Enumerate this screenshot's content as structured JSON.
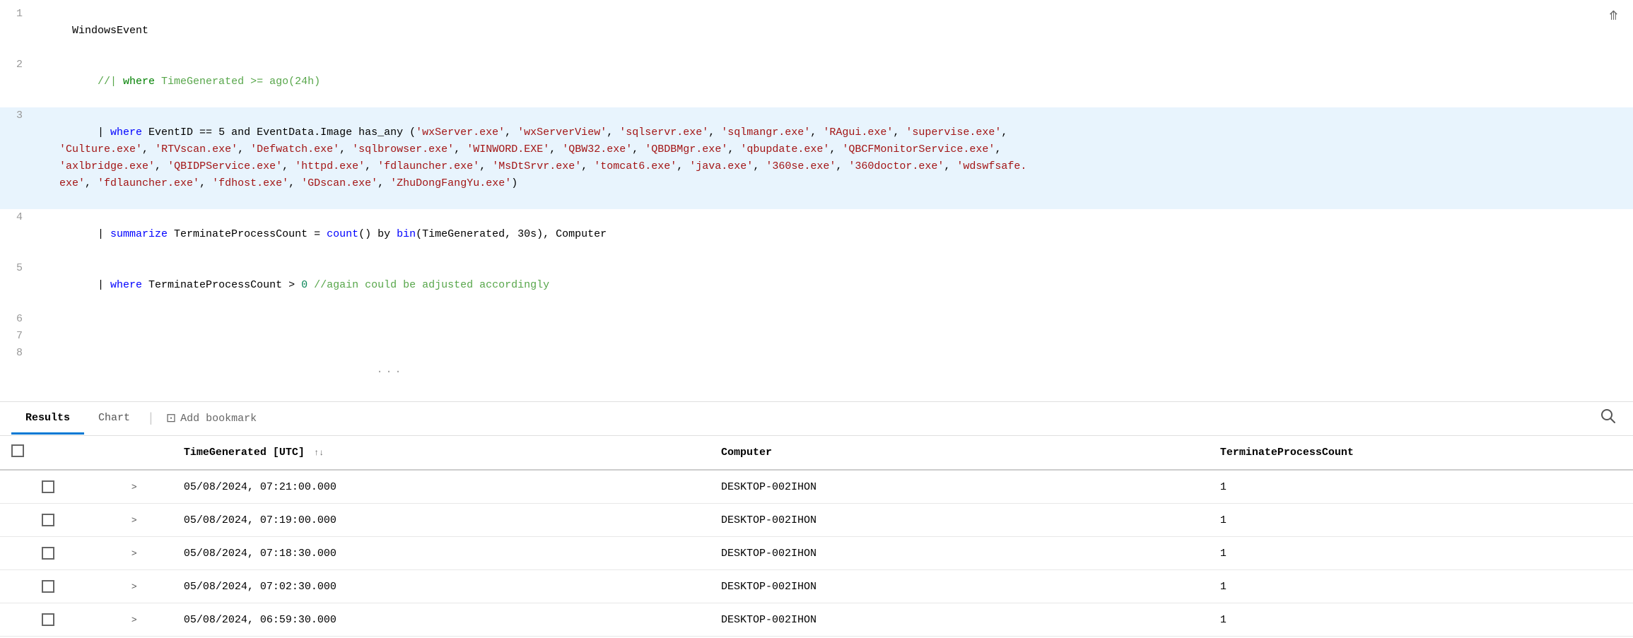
{
  "editor": {
    "lines": [
      {
        "number": "1",
        "tokens": [
          {
            "text": "WindowsEvent",
            "type": "plain"
          }
        ],
        "highlighted": false,
        "commented": false
      },
      {
        "number": "2",
        "tokens": [
          {
            "text": "    //| where TimeGenerated >= ago(24h)",
            "type": "comment"
          }
        ],
        "highlighted": false,
        "commented": true
      },
      {
        "number": "3",
        "tokens": [],
        "highlighted": true,
        "commented": false,
        "raw": "    | where EventID == 5 and EventData.Image has_any ('wxServer.exe', 'wxServerView.exe', 'sqlservr.exe', 'sqlmangr.exe', 'RAgui.exe', 'supervise.exe', 'Culture.exe', 'RTVscan.exe', 'Defwatch.exe', 'sqlbrowser.exe', 'WINWORD.EXE', 'QBW32.exe', 'QBDBMgr.exe', 'qbupdate.exe', 'QBCFMonitorService.exe', 'axlbridge.exe', 'QBIDPService.exe', 'httpd.exe', 'fdlauncher.exe', 'MsDtSrvr.exe', 'tomcat6.exe', 'java.exe', '360se.exe', '360doctor.exe', 'wdswfsafe.exe', 'fdlauncher.exe', 'fdhost.exe', 'GDscan.exe', 'ZhuDongFangYu.exe')"
      },
      {
        "number": "4",
        "tokens": [
          {
            "text": "    | ",
            "type": "plain"
          },
          {
            "text": "summarize",
            "type": "keyword"
          },
          {
            "text": " TerminateProcessCount = ",
            "type": "plain"
          },
          {
            "text": "count",
            "type": "keyword"
          },
          {
            "text": "() by ",
            "type": "plain"
          },
          {
            "text": "bin",
            "type": "keyword"
          },
          {
            "text": "(TimeGenerated, 30s), Computer",
            "type": "plain"
          }
        ],
        "highlighted": false,
        "commented": false
      },
      {
        "number": "5",
        "tokens": [
          {
            "text": "    | ",
            "type": "plain"
          },
          {
            "text": "where",
            "type": "keyword"
          },
          {
            "text": " TerminateProcessCount > ",
            "type": "plain"
          },
          {
            "text": "0",
            "type": "number"
          },
          {
            "text": " //again could be adjusted accordingly",
            "type": "comment"
          }
        ],
        "highlighted": false,
        "commented": false
      },
      {
        "number": "6",
        "tokens": [],
        "highlighted": false,
        "commented": false
      },
      {
        "number": "7",
        "tokens": [],
        "highlighted": false,
        "commented": false
      },
      {
        "number": "8",
        "tokens": [],
        "highlighted": false,
        "commented": false
      }
    ]
  },
  "results_tabs": {
    "tabs": [
      {
        "label": "Results",
        "active": true
      },
      {
        "label": "Chart",
        "active": false
      }
    ],
    "add_bookmark_label": "Add bookmark",
    "ellipsis": "..."
  },
  "table": {
    "headers": [
      {
        "label": "TimeGenerated [UTC]",
        "sortable": true,
        "key": "time"
      },
      {
        "label": "Computer",
        "sortable": false,
        "key": "computer"
      },
      {
        "label": "TerminateProcessCount",
        "sortable": false,
        "key": "count"
      }
    ],
    "rows": [
      {
        "time": "05/08/2024, 07:21:00.000",
        "computer": "DESKTOP-002IHON",
        "count": "1"
      },
      {
        "time": "05/08/2024, 07:19:00.000",
        "computer": "DESKTOP-002IHON",
        "count": "1"
      },
      {
        "time": "05/08/2024, 07:18:30.000",
        "computer": "DESKTOP-002IHON",
        "count": "1"
      },
      {
        "time": "05/08/2024, 07:02:30.000",
        "computer": "DESKTOP-002IHON",
        "count": "1"
      },
      {
        "time": "05/08/2024, 06:59:30.000",
        "computer": "DESKTOP-002IHON",
        "count": "1"
      }
    ]
  }
}
